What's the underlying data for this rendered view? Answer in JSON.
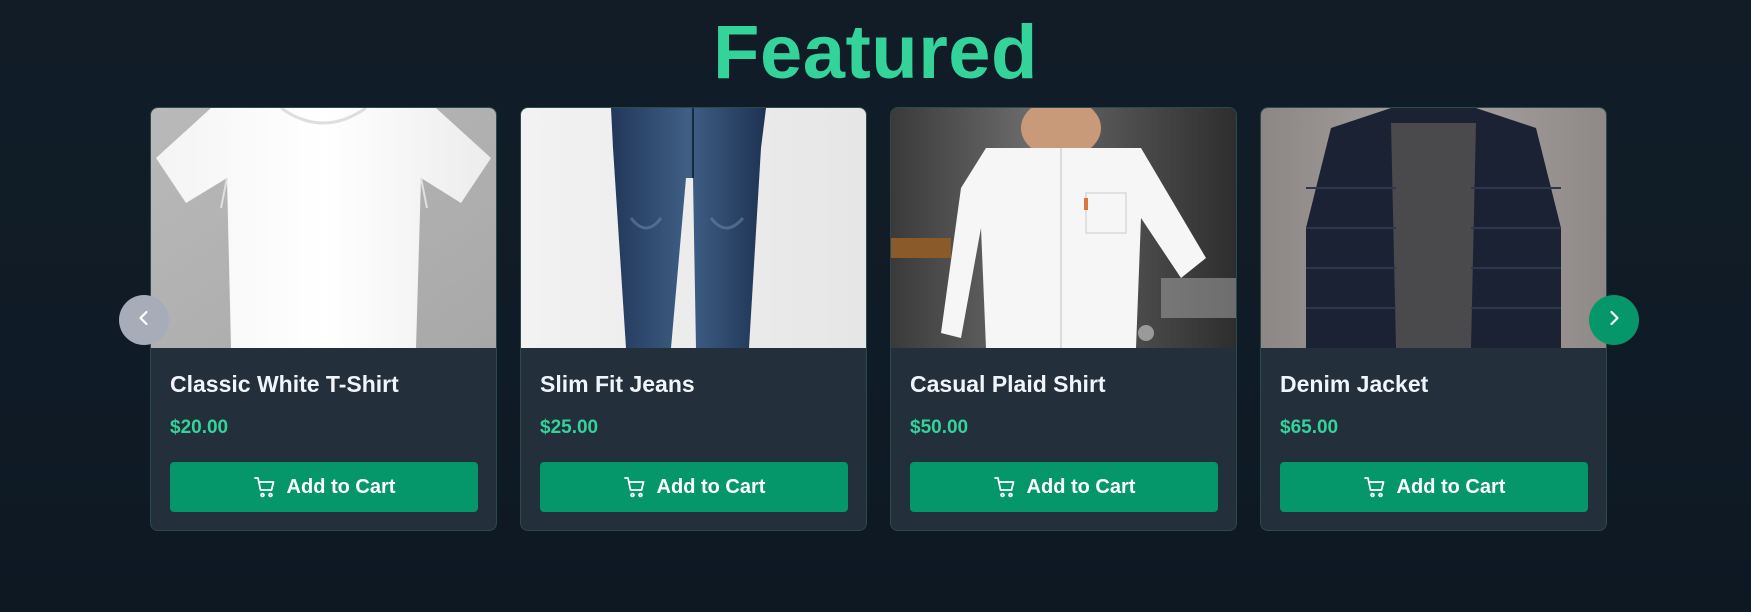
{
  "section": {
    "title": "Featured"
  },
  "products": [
    {
      "name": "Classic White T-Shirt",
      "price": "$20.00",
      "button_label": "Add to Cart",
      "image": "white-tshirt"
    },
    {
      "name": "Slim Fit Jeans",
      "price": "$25.00",
      "button_label": "Add to Cart",
      "image": "blue-jeans"
    },
    {
      "name": "Casual Plaid Shirt",
      "price": "$50.00",
      "button_label": "Add to Cart",
      "image": "white-shirt-man"
    },
    {
      "name": "Denim Jacket",
      "price": "$65.00",
      "button_label": "Add to Cart",
      "image": "navy-puffer-jacket"
    }
  ],
  "carousel": {
    "prev_icon": "chevron-left-icon",
    "next_icon": "chevron-right-icon"
  },
  "colors": {
    "accent": "#34d399",
    "button": "#059669",
    "card": "#232f3b",
    "background": "#111c27"
  }
}
